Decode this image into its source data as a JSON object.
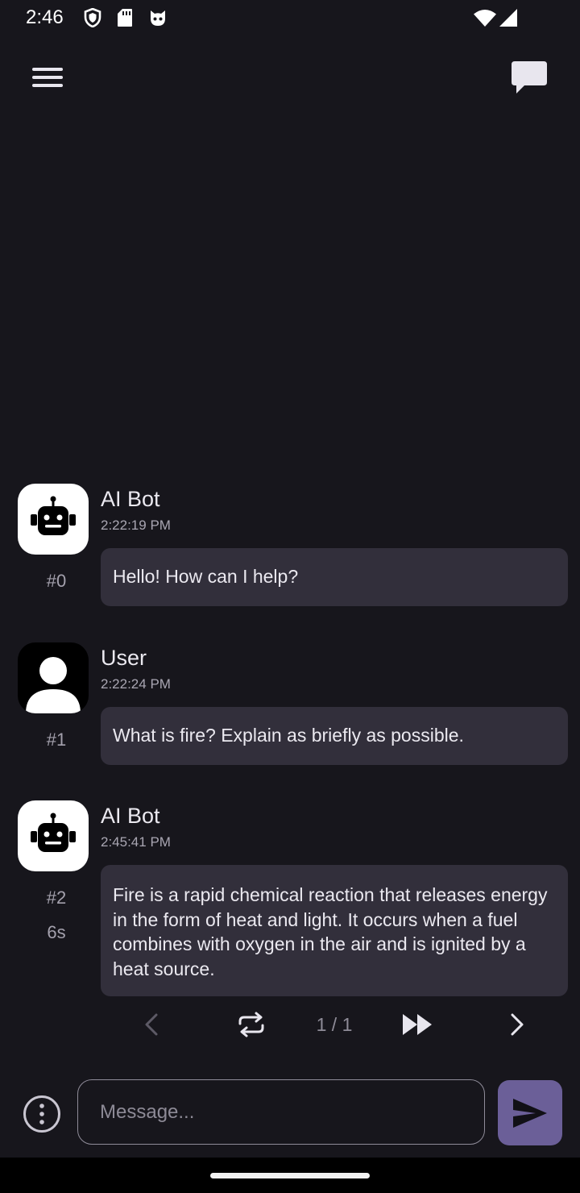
{
  "status_bar": {
    "time": "2:46",
    "icons": [
      "shield-icon",
      "sd-card-icon",
      "cat-icon",
      "wifi-icon",
      "signal-icon"
    ]
  },
  "app_bar": {
    "menu_icon": "menu-icon",
    "chat_icon": "chat-bubble-icon"
  },
  "messages": [
    {
      "sender": "AI Bot",
      "time": "2:22:19 PM",
      "index": "#0",
      "text": "Hello! How can I help?",
      "avatar": "robot-icon"
    },
    {
      "sender": "User",
      "time": "2:22:24 PM",
      "index": "#1",
      "text": "What is fire? Explain as briefly as possible.",
      "avatar": "person-icon"
    },
    {
      "sender": "AI Bot",
      "time": "2:45:41 PM",
      "index": "#2",
      "duration": "6s",
      "text": "Fire is a rapid chemical reaction that releases energy in the form of heat and light. It occurs when a fuel combines with oxygen in the air and is ignited by a heat source.",
      "avatar": "robot-icon"
    }
  ],
  "response_controls": {
    "page_indicator": "1 / 1",
    "icons": [
      "chevron-left-icon",
      "regenerate-icon",
      "fast-forward-icon",
      "chevron-right-icon"
    ]
  },
  "composer": {
    "placeholder": "Message...",
    "value": "",
    "info_icon": "info-icon",
    "send_icon": "send-icon"
  },
  "colors": {
    "background": "#17161c",
    "bubble": "#322f3b",
    "send_button": "#6b5f98"
  }
}
